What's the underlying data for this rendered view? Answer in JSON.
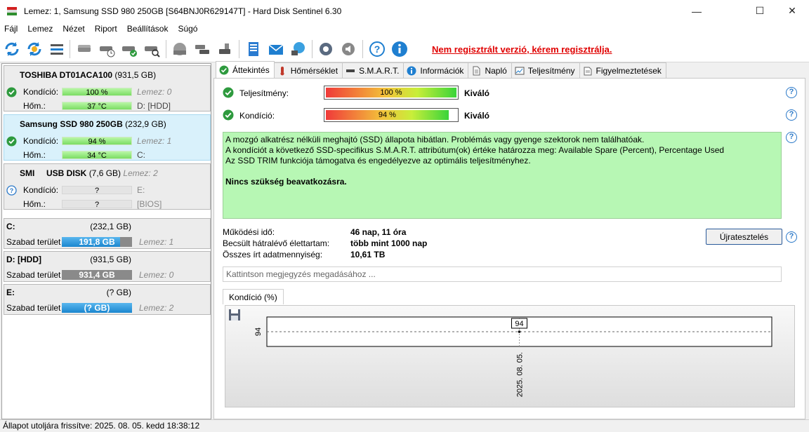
{
  "window": {
    "title": "Lemez: 1, Samsung SSD 980 250GB [S64BNJ0R629147T]  -  Hard Disk Sentinel 6.30",
    "minimize_glyph": "—",
    "maximize_glyph": "☐",
    "close_glyph": "✕"
  },
  "menu": [
    "Fájl",
    "Lemez",
    "Nézet",
    "Riport",
    "Beállítások",
    "Súgó"
  ],
  "toolbar": {
    "registration_notice": "Nem regisztrált verzió, kérem regisztrálja.",
    "icons": [
      "refresh-icon",
      "refresh-all-icon",
      "disk-list-icon",
      "disk-icon",
      "disk-schedule-icon",
      "disk-check-icon",
      "disk-search-icon",
      "disk-surface-icon",
      "disk-copy-icon",
      "disk-usb-icon",
      "report-icon",
      "email-icon",
      "network-icon",
      "settings-icon",
      "sound-icon",
      "help-icon",
      "info-icon"
    ]
  },
  "disks": [
    {
      "name": "TOSHIBA DT01ACA100",
      "size": "(931,5 GB)",
      "status": "ok",
      "condition_label": "Kondíció:",
      "condition_value": "100 %",
      "condition_extra": "Lemez: 0",
      "temp_label": "Hőm.:",
      "temp_value": "37 °C",
      "temp_extra": "D: [HDD]"
    },
    {
      "name": "Samsung SSD 980 250GB",
      "size": "(232,9 GB)",
      "status": "ok",
      "condition_label": "Kondíció:",
      "condition_value": "94 %",
      "condition_extra": "Lemez: 1",
      "temp_label": "Hőm.:",
      "temp_value": "34 °C",
      "temp_extra": "C:"
    },
    {
      "name": "SMI     USB DISK",
      "size": "(7,6 GB)",
      "extra_title": "Lemez: 2",
      "status": "unknown",
      "condition_label": "Kondíció:",
      "condition_value": "?",
      "condition_extra": "E:",
      "temp_label": "Hőm.:",
      "temp_value": "?",
      "temp_extra": "[BIOS]"
    }
  ],
  "volumes": [
    {
      "name": "C:",
      "size": "(232,1 GB)",
      "free_label": "Szabad terület",
      "free_value": "191,8 GB",
      "free_fraction": 0.83,
      "extra": "Lemez: 1"
    },
    {
      "name": "D: [HDD]",
      "size": "(931,5 GB)",
      "free_label": "Szabad terület",
      "free_value": "931,4 GB",
      "free_fraction": 0.0,
      "extra": "Lemez: 0"
    },
    {
      "name": "E:",
      "size": "(? GB)",
      "free_label": "Szabad terület",
      "free_value": "(? GB)",
      "free_fraction": 1.0,
      "extra": "Lemez: 2"
    }
  ],
  "tabs": [
    "Áttekintés",
    "Hőmérséklet",
    "S.M.A.R.T.",
    "Információk",
    "Napló",
    "Teljesítmény",
    "Figyelmeztetések"
  ],
  "overview": {
    "performance": {
      "label": "Teljesítmény:",
      "value": "100 %",
      "percent": 100,
      "verdict": "Kiváló"
    },
    "condition": {
      "label": "Kondíció:",
      "value": "94 %",
      "percent": 94,
      "verdict": "Kiváló"
    },
    "status_lines": [
      "A mozgó alkatrész nélküli meghajtó (SSD) állapota hibátlan. Problémás vagy gyenge szektorok nem találhatóak.",
      "A kondíciót a következő SSD-specifikus S.M.A.R.T. attribútum(ok) értéke határozza meg:  Available Spare (Percent), Percentage Used",
      "Az SSD TRIM funkciója támogatva és engedélyezve az optimális teljesítményhez."
    ],
    "status_conclusion": "Nincs szükség beavatkozásra.",
    "uptime_label": "Működési idő:",
    "uptime_value": "46 nap, 11 óra",
    "lifetime_label": "Becsült hátralévő élettartam:",
    "lifetime_value": "több mint 1000 nap",
    "written_label": "Összes írt adatmennyiség:",
    "written_value": "10,61 TB",
    "retest_label": "Újratesztelés",
    "note_placeholder": "Kattintson megjegyzés megadásához ...",
    "help_glyph": "?"
  },
  "chart_tab_label": "Kondíció  (%)",
  "chart_data": {
    "type": "line",
    "x": [
      "2025. 08. 05."
    ],
    "series": [
      {
        "values": [
          94
        ]
      }
    ],
    "y_tick_labels": [
      "94"
    ],
    "data_labels": [
      "94"
    ]
  },
  "statusbar": {
    "text": "Állapot utoljára frissítve: 2025. 08. 05. kedd 18:38:12"
  },
  "colors": {
    "ok_green": "#2e9a3e",
    "info_blue": "#2a78c8",
    "notice_red": "#e00000",
    "status_box_bg": "#b7f7b4",
    "selected_card": "#d9f1fb"
  }
}
